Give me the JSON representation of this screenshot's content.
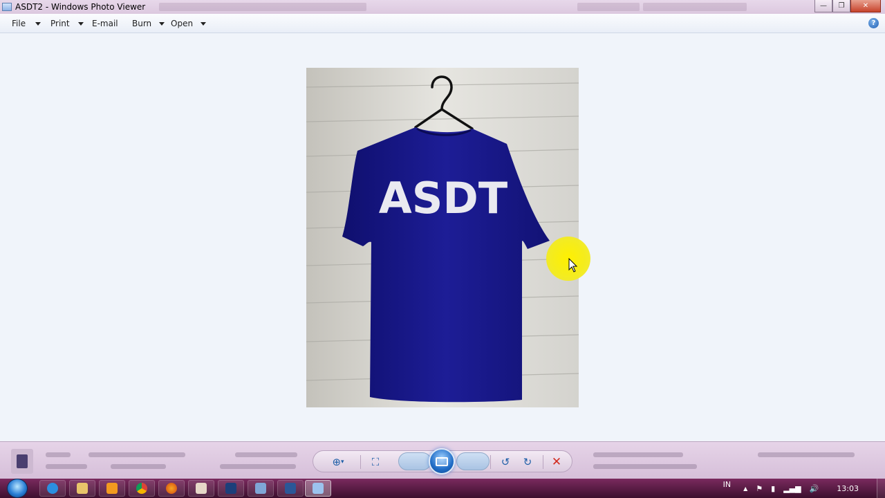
{
  "window": {
    "title": "ASDT2 - Windows Photo Viewer",
    "minimize_glyph": "—",
    "maximize_glyph": "❐",
    "close_glyph": "✕"
  },
  "menubar": {
    "items": [
      {
        "label": "File",
        "has_dropdown": true
      },
      {
        "label": "Print",
        "has_dropdown": true
      },
      {
        "label": "E-mail",
        "has_dropdown": false
      },
      {
        "label": "Burn",
        "has_dropdown": true
      },
      {
        "label": "Open",
        "has_dropdown": true
      }
    ],
    "help_glyph": "?"
  },
  "photo": {
    "shirt_text": "ASDT",
    "shirt_color": "#1a1a8c",
    "background": "#d6d6d0"
  },
  "controls": {
    "zoom_icon": "zoom-icon",
    "actual_size_icon": "actual-size-icon",
    "previous_icon": "previous-icon",
    "slideshow_icon": "slideshow-icon",
    "next_icon": "next-icon",
    "rotate_ccw_icon": "rotate-counterclockwise-icon",
    "rotate_cw_icon": "rotate-clockwise-icon",
    "delete_icon": "delete-icon",
    "zoom_glyph": "⊕",
    "zoom_dropdown_glyph": "▾",
    "actual_size_glyph": "⛶",
    "previous_glyph": "⏮",
    "next_glyph": "⏭",
    "rotate_ccw_glyph": "↺",
    "rotate_cw_glyph": "↻",
    "delete_glyph": "✕"
  },
  "taskbar": {
    "language": "IN",
    "clock": "13:03",
    "tray_up_glyph": "▲",
    "volume_glyph": "🔊"
  },
  "colors": {
    "accent": "#1f5fa8",
    "delete": "#d12a1e",
    "cursor_highlight": "#f4ec1e",
    "taskbar": "#5a1c46"
  }
}
